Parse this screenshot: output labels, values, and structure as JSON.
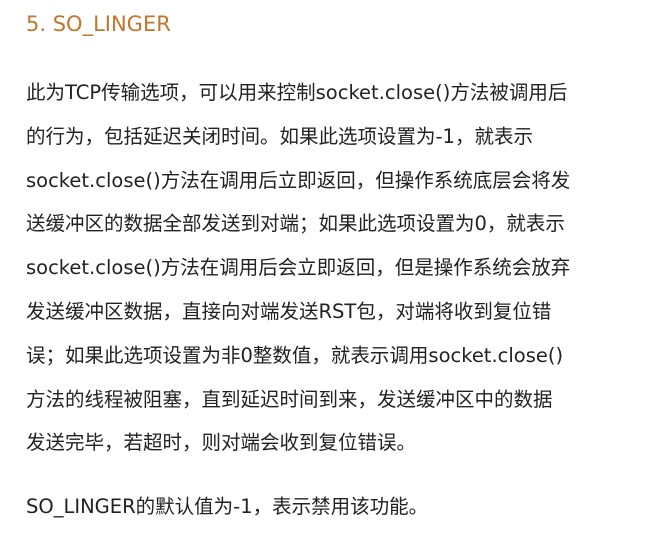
{
  "article": {
    "heading": "5. SO_LINGER",
    "body": "此为TCP传输选项，可以用来控制socket.close()方法被调用后\n的行为，包括延迟关闭时间。如果此选项设置为-1，就表示\nsocket.close()方法在调用后立即返回，但操作系统底层会将发\n送缓冲区的数据全部发送到对端；如果此选项设置为0，就表示\nsocket.close()方法在调用后会立即返回，但是操作系统会放弃\n发送缓冲区数据，直接向对端发送RST包，对端将收到复位错\n误；如果此选项设置为非0整数值，就表示调用socket.close()\n方法的线程被阻塞，直到延迟时间到来，发送缓冲区中的数据\n发送完毕，若超时，则对端会收到复位错误。",
    "default_note": "SO_LINGER的默认值为-1，表示禁用该功能。"
  },
  "colors": {
    "heading": "#c0762c",
    "text": "#222222",
    "background": "#ffffff"
  }
}
